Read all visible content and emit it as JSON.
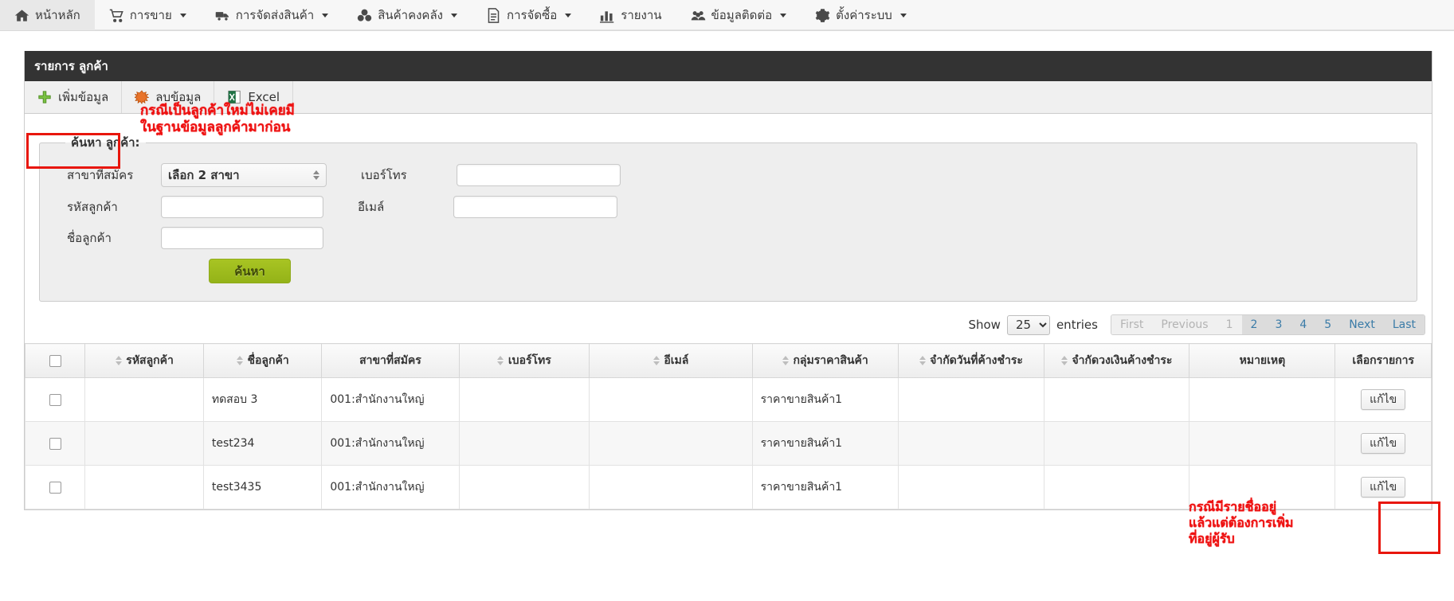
{
  "navbar": {
    "items": [
      {
        "label": "หน้าหลัก",
        "icon": "home-icon",
        "caret": false,
        "active": true
      },
      {
        "label": "การขาย",
        "icon": "cart-icon",
        "caret": true,
        "active": false
      },
      {
        "label": "การจัดส่งสินค้า",
        "icon": "truck-icon",
        "caret": true,
        "active": false
      },
      {
        "label": "สินค้าคงคลัง",
        "icon": "boxes-icon",
        "caret": true,
        "active": false
      },
      {
        "label": "การจัดซื้อ",
        "icon": "document-icon",
        "caret": true,
        "active": false
      },
      {
        "label": "รายงาน",
        "icon": "bar-chart-icon",
        "caret": false,
        "active": false
      },
      {
        "label": "ข้อมูลติดต่อ",
        "icon": "users-icon",
        "caret": true,
        "active": false
      },
      {
        "label": "ตั้งค่าระบบ",
        "icon": "gear-icon",
        "caret": true,
        "active": false
      }
    ]
  },
  "panel": {
    "title": "รายการ ลูกค้า"
  },
  "toolbar": {
    "add_label": "เพิ่มข้อมูล",
    "delete_label": "ลบข้อมูล",
    "excel_label": "Excel"
  },
  "annotations": {
    "add_note": "กรณีเป็นลูกค้าใหม่ไม่เคยมี\nในฐานข้อมูลลูกค้ามาก่อน",
    "edit_note": "กรณีมีรายชื่ออยู่\nแล้วแต่ต้องการเพิ่ม\nที่อยู่ผู้รับ",
    "highlight_color": "#e8160c"
  },
  "search": {
    "legend": "ค้นหา ลูกค้า:",
    "branch_label": "สาขาที่สมัคร",
    "branch_value": "เลือก 2 สาขา",
    "code_label": "รหัสลูกค้า",
    "code_value": "",
    "name_label": "ชื่อลูกค้า",
    "name_value": "",
    "phone_label": "เบอร์โทร",
    "phone_value": "",
    "email_label": "อีเมล์",
    "email_value": "",
    "submit_label": "ค้นหา"
  },
  "paging": {
    "show_label": "Show",
    "entries_label": "entries",
    "page_length": "25",
    "buttons": [
      {
        "label": "First",
        "state": "disabled"
      },
      {
        "label": "Previous",
        "state": "disabled"
      },
      {
        "label": "1",
        "state": "current"
      },
      {
        "label": "2",
        "state": "enabled"
      },
      {
        "label": "3",
        "state": "enabled"
      },
      {
        "label": "4",
        "state": "enabled"
      },
      {
        "label": "5",
        "state": "enabled"
      },
      {
        "label": "Next",
        "state": "enabled"
      },
      {
        "label": "Last",
        "state": "enabled"
      }
    ]
  },
  "table": {
    "headers": [
      {
        "label": "",
        "sortable": false
      },
      {
        "label": "รหัสลูกค้า",
        "sortable": true
      },
      {
        "label": "ชื่อลูกค้า",
        "sortable": true
      },
      {
        "label": "สาขาที่สมัคร",
        "sortable": false
      },
      {
        "label": "เบอร์โทร",
        "sortable": true
      },
      {
        "label": "อีเมล์",
        "sortable": true
      },
      {
        "label": "กลุ่มราคาสินค้า",
        "sortable": true
      },
      {
        "label": "จำกัดวันที่ค้างชำระ",
        "sortable": true
      },
      {
        "label": "จำกัดวงเงินค้างชำระ",
        "sortable": true
      },
      {
        "label": "หมายเหตุ",
        "sortable": false
      },
      {
        "label": "เลือกรายการ",
        "sortable": false
      }
    ],
    "edit_label": "แก้ไข",
    "rows": [
      {
        "code": "",
        "name": "ทดสอบ 3",
        "branch": "001:สำนักงานใหญ่",
        "phone": "",
        "email": "",
        "price_group": "ราคาขายสินค้า1",
        "overdue_days": "",
        "overdue_limit": "",
        "note": ""
      },
      {
        "code": "",
        "name": "test234",
        "branch": "001:สำนักงานใหญ่",
        "phone": "",
        "email": "",
        "price_group": "ราคาขายสินค้า1",
        "overdue_days": "",
        "overdue_limit": "",
        "note": ""
      },
      {
        "code": "",
        "name": "test3435",
        "branch": "001:สำนักงานใหญ่",
        "phone": "",
        "email": "",
        "price_group": "ราคาขายสินค้า1",
        "overdue_days": "",
        "overdue_limit": "",
        "note": ""
      }
    ]
  }
}
